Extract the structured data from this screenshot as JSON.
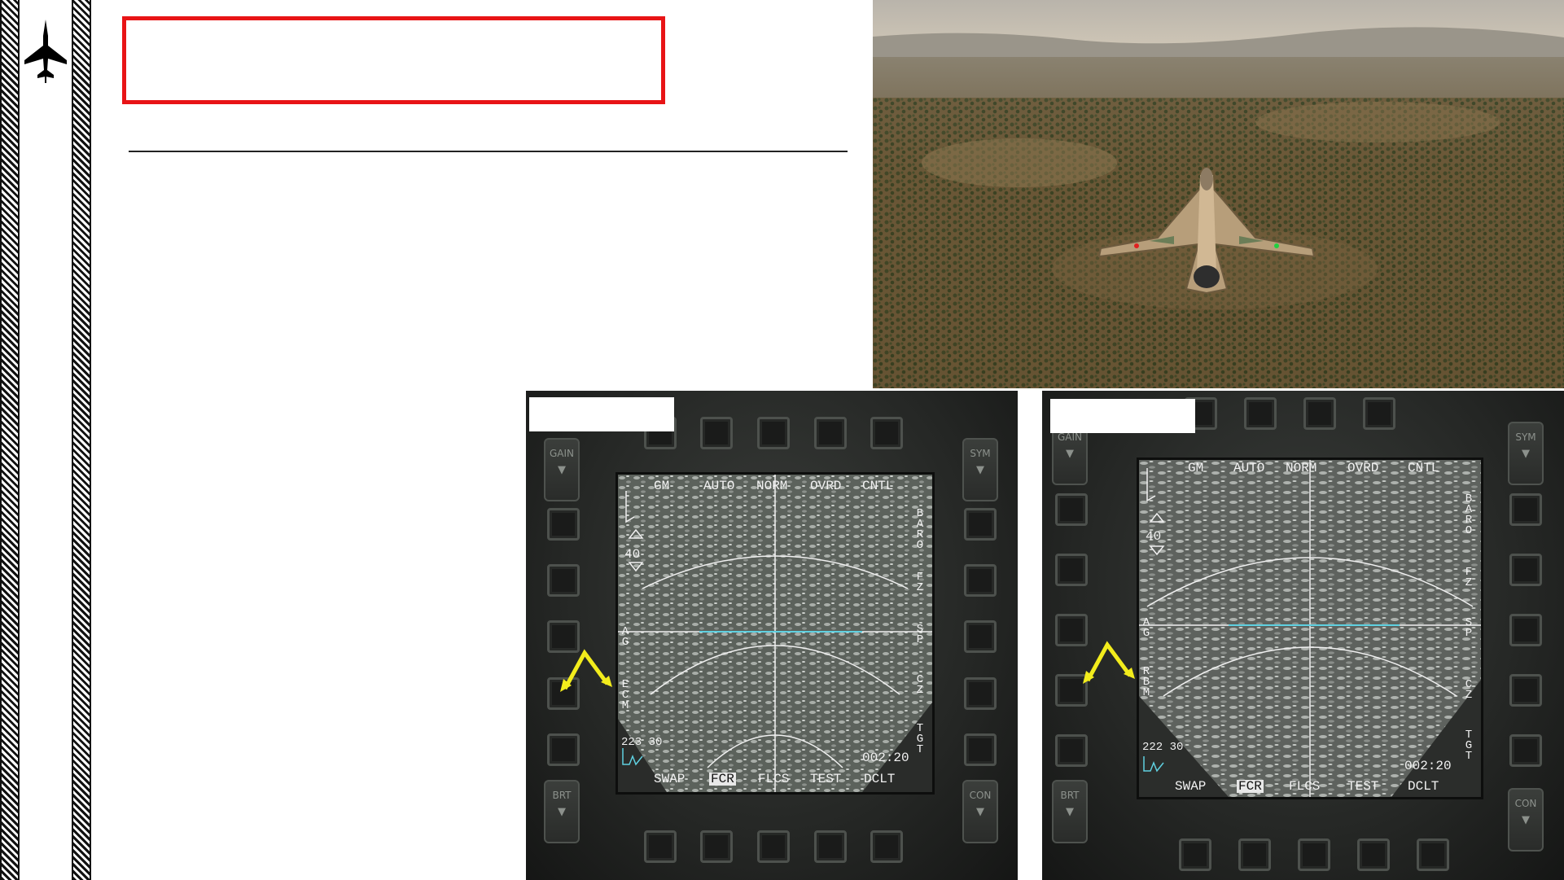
{
  "page": {
    "title": "",
    "body": ""
  },
  "colors": {
    "title_border": "#e81416",
    "arrow": "#f2ec1c",
    "symbology_cyan": "#5fd0e0"
  },
  "icons": {
    "sidebar": "jet-silhouette-icon"
  },
  "photo": {
    "subject": "aircraft-over-terrain-image"
  },
  "mfd_left": {
    "caption": "",
    "top_labels": [
      "GM",
      "AUTO",
      "NORM",
      "OVRD",
      "CNTL"
    ],
    "right_labels": [
      "BARO",
      "FZ",
      "SP",
      "CZ",
      "TGT"
    ],
    "left_labels": [
      "AG",
      "ECM"
    ],
    "bottom_labels": [
      "SWAP",
      "FCR",
      "FLCS",
      "TEST",
      "DCLT"
    ],
    "range": "40",
    "bearing": "223 30",
    "time": "002:20",
    "rocker_left_top": "GAIN",
    "rocker_left_bottom": "BRT",
    "rocker_right_top": "SYM",
    "rocker_right_bottom": "CON"
  },
  "mfd_right": {
    "caption": "",
    "top_labels": [
      "GM",
      "AUTO",
      "NORM",
      "OVRD",
      "CNTL"
    ],
    "right_labels": [
      "BARO",
      "FZ",
      "SP",
      "CZ",
      "TGT"
    ],
    "left_labels": [
      "AG",
      "RBM"
    ],
    "bottom_labels": [
      "SWAP",
      "FCR",
      "FLCS",
      "TEST",
      "DCLT"
    ],
    "range": "40",
    "bearing": "222 30",
    "time": "002:20",
    "rocker_left_top": "GAIN",
    "rocker_left_bottom": "BRT",
    "rocker_right_top": "SYM",
    "rocker_right_bottom": "CON"
  }
}
